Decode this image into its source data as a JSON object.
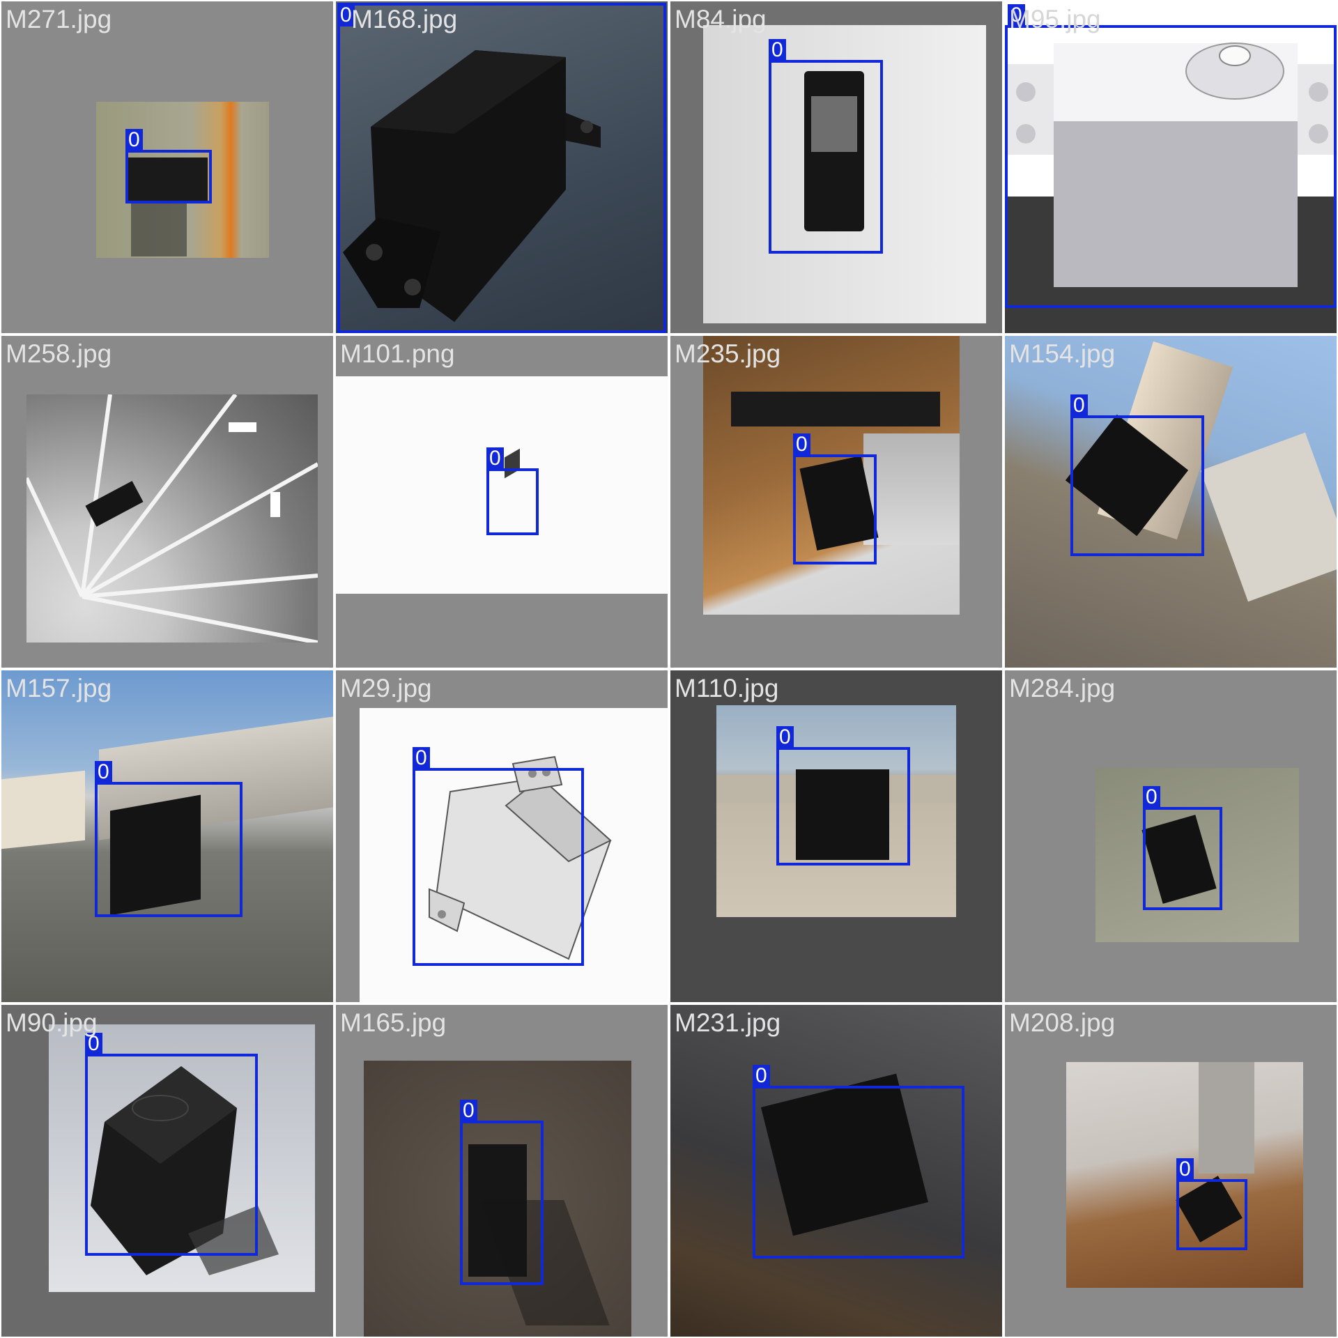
{
  "tiles": [
    {
      "filename": "M271.jpg",
      "label": "0"
    },
    {
      "filename": "M168.jpg",
      "label": "0"
    },
    {
      "filename": "M84.jpg",
      "label": "0"
    },
    {
      "filename": "M95.jpg",
      "label": "0"
    },
    {
      "filename": "M258.jpg",
      "label": ""
    },
    {
      "filename": "M101.png",
      "label": "0"
    },
    {
      "filename": "M235.jpg",
      "label": "0"
    },
    {
      "filename": "M154.jpg",
      "label": "0"
    },
    {
      "filename": "M157.jpg",
      "label": "0"
    },
    {
      "filename": "M29.jpg",
      "label": "0"
    },
    {
      "filename": "M110.jpg",
      "label": "0"
    },
    {
      "filename": "M284.jpg",
      "label": "0"
    },
    {
      "filename": "M90.jpg",
      "label": "0"
    },
    {
      "filename": "M165.jpg",
      "label": "0"
    },
    {
      "filename": "M231.jpg",
      "label": "0"
    },
    {
      "filename": "M208.jpg",
      "label": "0"
    }
  ],
  "colors": {
    "box": "#1028d8",
    "tile_bg": "#8a8a8a",
    "filename_text": "#e4e4e4"
  }
}
